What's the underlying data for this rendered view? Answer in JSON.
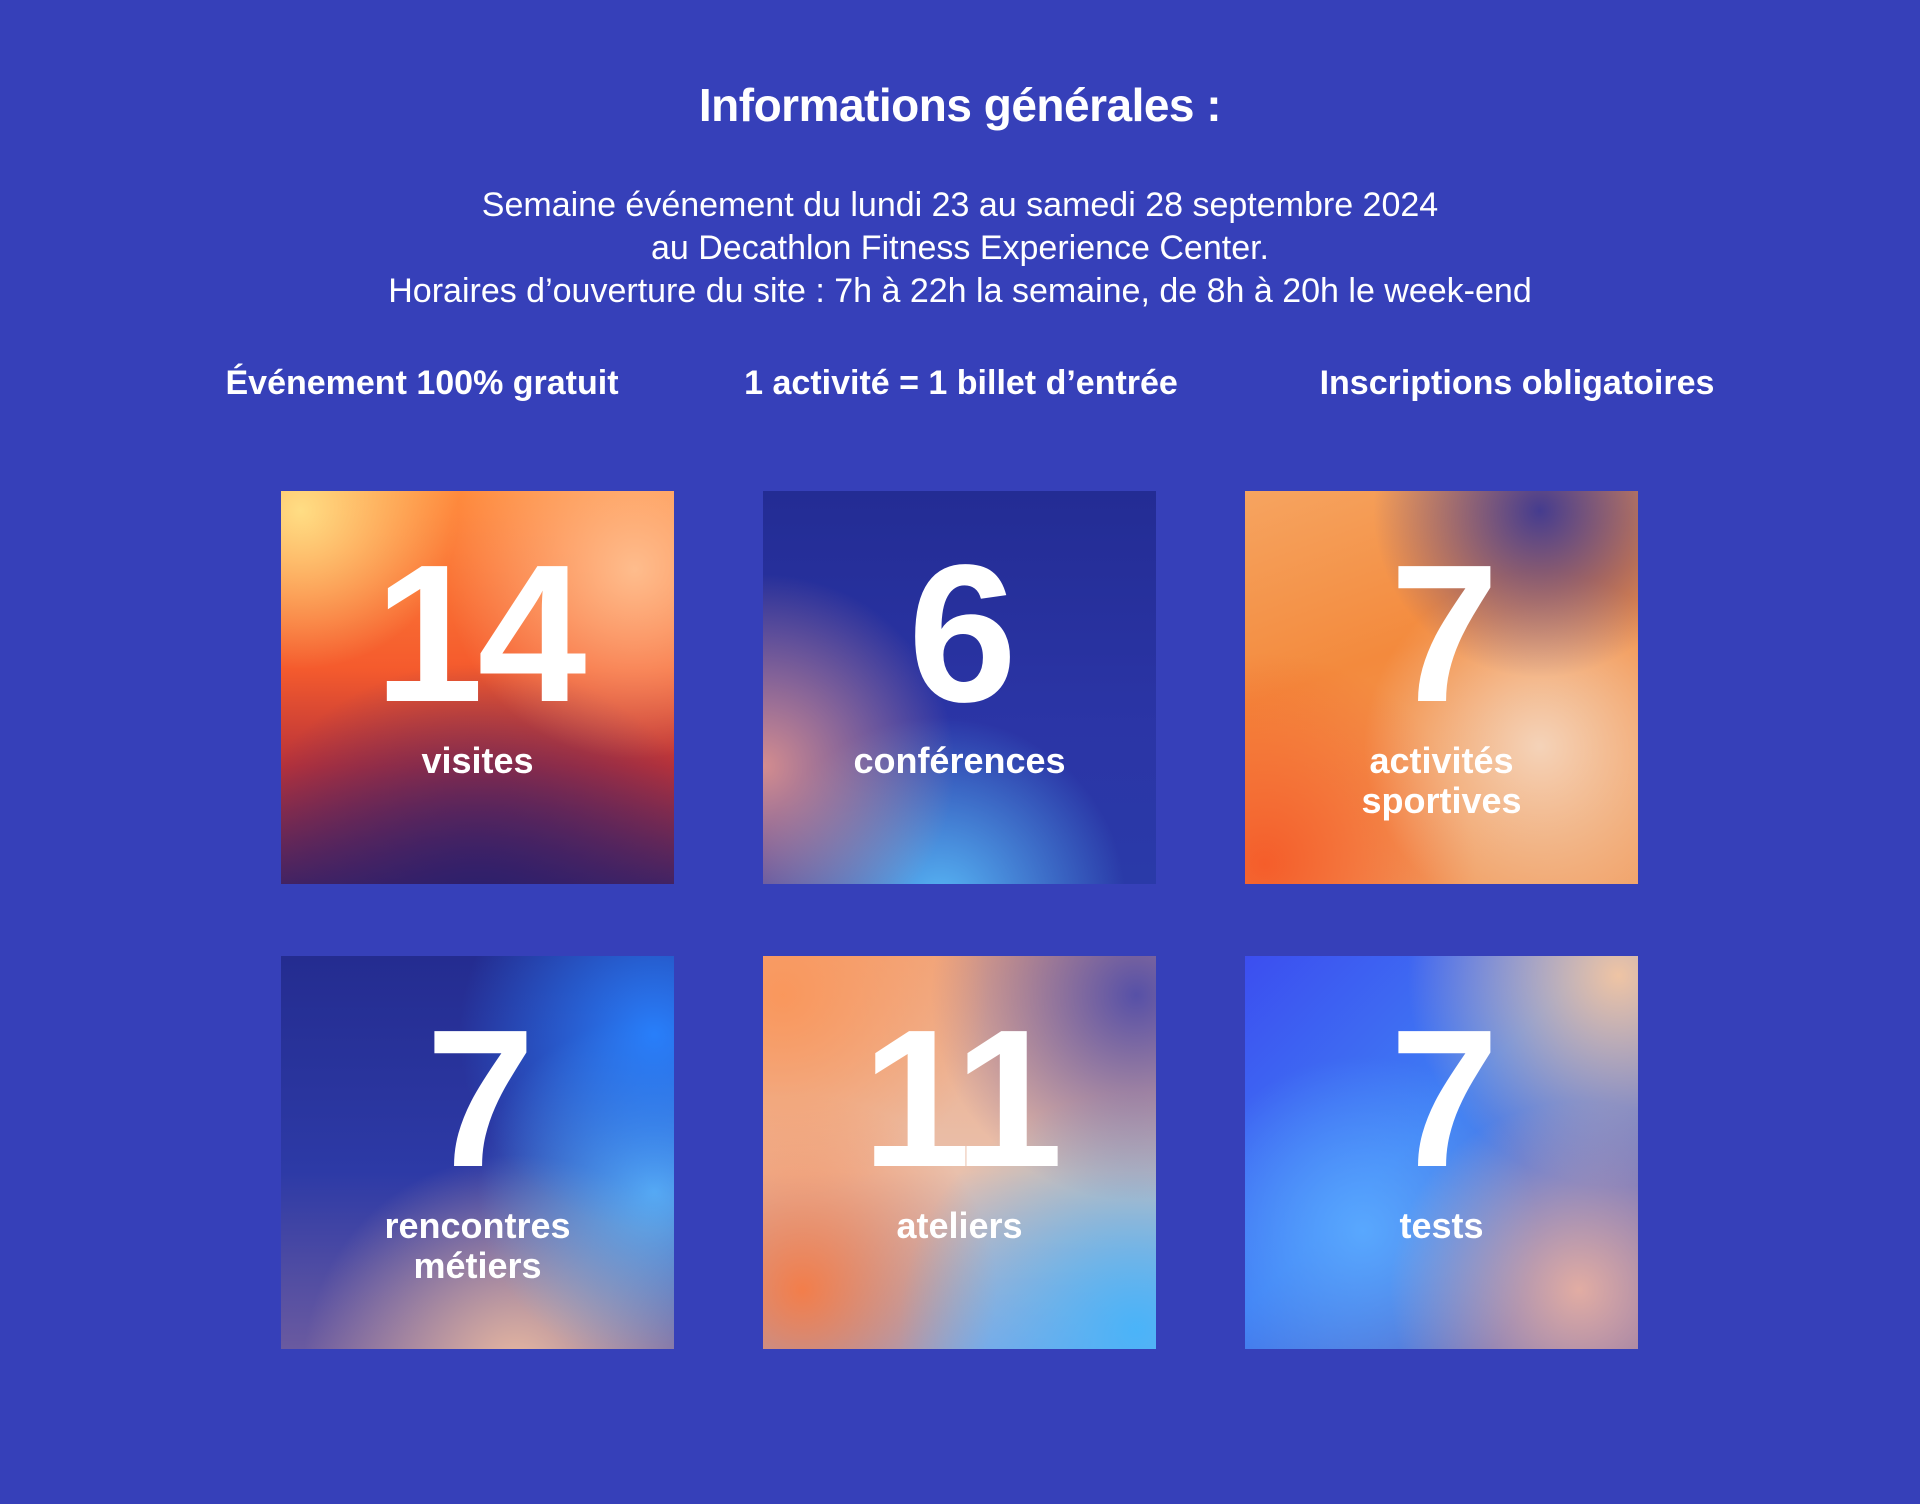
{
  "title": "Informations générales :",
  "intro": {
    "line1": "Semaine événement du lundi 23 au samedi 28 septembre 2024",
    "line2": "au Decathlon Fitness Experience Center.",
    "line3": "Horaires d’ouverture du site : 7h à  22h la semaine, de 8h à 20h le week-end"
  },
  "highlights": [
    "Événement 100% gratuit",
    "1 activité = 1 billet d’entrée",
    "Inscriptions obligatoires"
  ],
  "stats": [
    {
      "number": "14",
      "label": "visites"
    },
    {
      "number": "6",
      "label": "conférences"
    },
    {
      "number": "7",
      "label": "activités\nsportives"
    },
    {
      "number": "7",
      "label": "rencontres\nmétiers"
    },
    {
      "number": "11",
      "label": "ateliers"
    },
    {
      "number": "7",
      "label": "tests"
    }
  ],
  "colors": {
    "background": "#3640b9",
    "text": "#ffffff"
  }
}
